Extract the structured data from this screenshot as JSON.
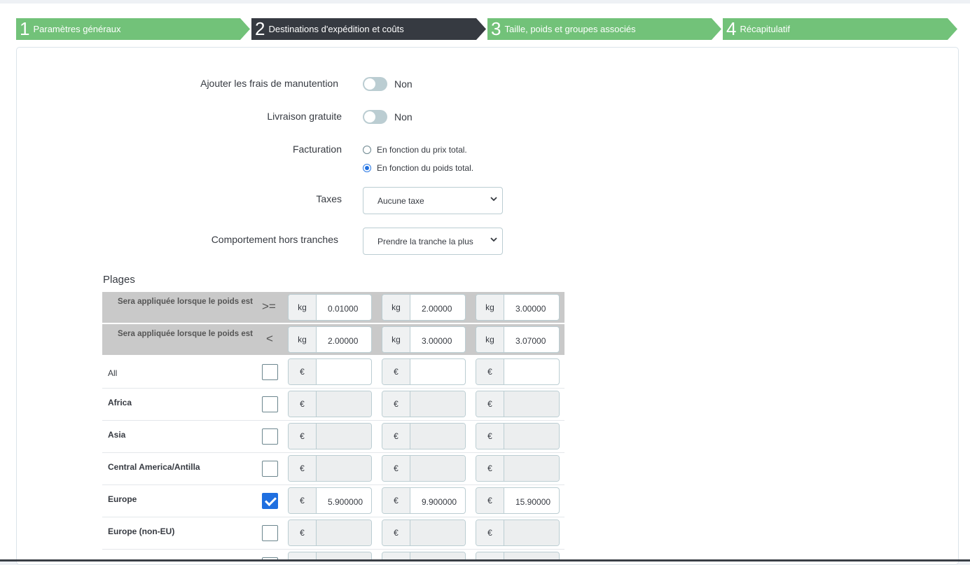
{
  "steps": [
    {
      "num": "1",
      "label": "Paramètres généraux",
      "state": "done"
    },
    {
      "num": "2",
      "label": "Destinations d'expédition et coûts",
      "state": "active"
    },
    {
      "num": "3",
      "label": "Taille, poids et groupes associés",
      "state": "done"
    },
    {
      "num": "4",
      "label": "Récapitulatif",
      "state": "done"
    }
  ],
  "form": {
    "handling": {
      "label": "Ajouter les frais de manutention",
      "value": "Non"
    },
    "free_shipping": {
      "label": "Livraison gratuite",
      "value": "Non"
    },
    "billing": {
      "label": "Facturation",
      "options": [
        "En fonction du prix total.",
        "En fonction du poids total."
      ],
      "selected": 1
    },
    "taxes": {
      "label": "Taxes",
      "value": "Aucune taxe"
    },
    "out_of_range": {
      "label": "Comportement hors tranches",
      "value": "Prendre la tranche la plus"
    }
  },
  "ranges": {
    "title": "Plages",
    "row_label": "Sera appliquée lorsque le poids est",
    "op_min": ">=",
    "op_max": "<",
    "unit": "kg",
    "min_values": [
      "0.01000",
      "2.00000",
      "3.00000"
    ],
    "max_values": [
      "2.00000",
      "3.00000",
      "3.07000"
    ]
  },
  "currency": "€",
  "zones": [
    {
      "name": "All",
      "checked": false,
      "prices": [
        "",
        "",
        ""
      ],
      "enabled": true,
      "bold": false
    },
    {
      "name": "Africa",
      "checked": false,
      "prices": [
        "",
        "",
        ""
      ],
      "enabled": false,
      "bold": true
    },
    {
      "name": "Asia",
      "checked": false,
      "prices": [
        "",
        "",
        ""
      ],
      "enabled": false,
      "bold": true
    },
    {
      "name": "Central America/Antilla",
      "checked": false,
      "prices": [
        "",
        "",
        ""
      ],
      "enabled": false,
      "bold": true
    },
    {
      "name": "Europe",
      "checked": true,
      "prices": [
        "5.900000",
        "9.900000",
        "15.90000"
      ],
      "enabled": true,
      "bold": true
    },
    {
      "name": "Europe (non-EU)",
      "checked": false,
      "prices": [
        "",
        "",
        ""
      ],
      "enabled": false,
      "bold": true
    }
  ]
}
